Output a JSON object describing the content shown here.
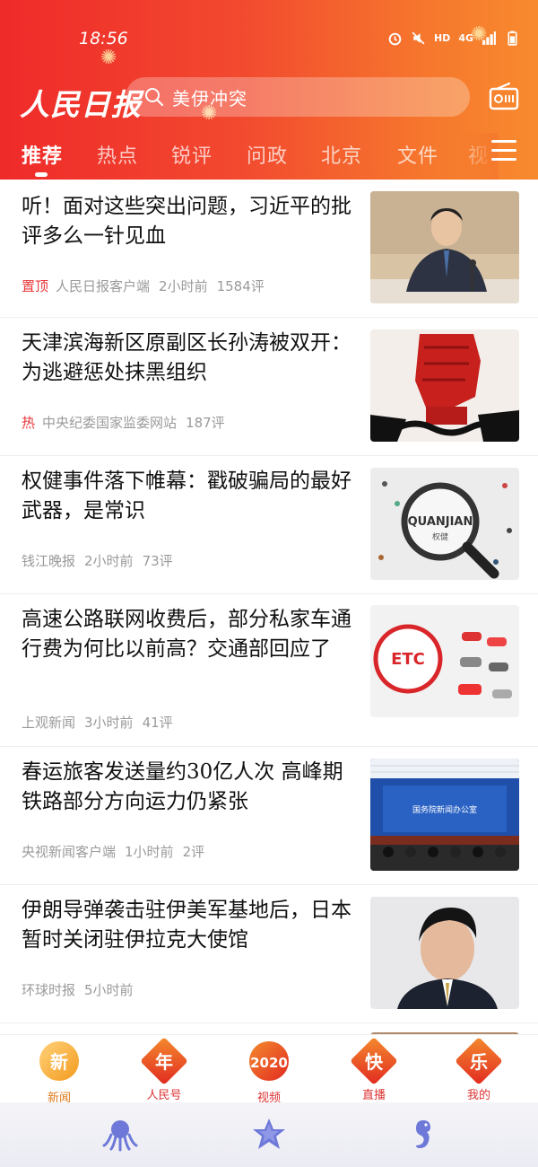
{
  "status": {
    "time": "18:56",
    "network": "4G"
  },
  "app": {
    "logo": "人民日报",
    "search_placeholder": "美伊冲突"
  },
  "tabs": [
    {
      "label": "推荐",
      "active": true
    },
    {
      "label": "热点",
      "active": false
    },
    {
      "label": "锐评",
      "active": false
    },
    {
      "label": "问政",
      "active": false
    },
    {
      "label": "北京",
      "active": false
    },
    {
      "label": "文件",
      "active": false
    },
    {
      "label": "视",
      "active": false
    }
  ],
  "feed": [
    {
      "title": "听！面对这些突出问题，习近平的批评多么一针见血",
      "tag": "置顶",
      "source": "人民日报客户端",
      "time": "2小时前",
      "comments": "1584评",
      "thumb": "podium-speaker"
    },
    {
      "title": "天津滨海新区原副区长孙涛被双开：为逃避惩处抹黑组织",
      "tag": "热",
      "source": "中央纪委国家监委网站",
      "time": "",
      "comments": "187评",
      "thumb": "red-fist"
    },
    {
      "title": "权健事件落下帷幕：戳破骗局的最好武器，是常识",
      "tag": "",
      "source": "钱江晚报",
      "time": "2小时前",
      "comments": "73评",
      "thumb": "magnifier",
      "thumb_text": "QUANJIAN",
      "thumb_subtext": "权健"
    },
    {
      "title": "高速公路联网收费后，部分私家车通行费为何比以前高？交通部回应了",
      "tag": "",
      "source": "上观新闻",
      "time": "3小时前",
      "comments": "41评",
      "thumb": "etc-cars",
      "thumb_text": "ETC"
    },
    {
      "title": "春运旅客发送量约30亿人次 高峰期铁路部分方向运力仍紧张",
      "tag": "",
      "source": "央视新闻客户端",
      "time": "1小时前",
      "comments": "2评",
      "thumb": "press-conference",
      "thumb_text": "国务院新闻办公室"
    },
    {
      "title": "伊朗导弹袭击驻伊美军基地后，日本暂时关闭驻伊拉克大使馆",
      "tag": "",
      "source": "环球时报",
      "time": "5小时前",
      "comments": "",
      "thumb": "portrait"
    }
  ],
  "bottom_nav": [
    {
      "glyph": "新",
      "label": "新闻"
    },
    {
      "glyph": "年",
      "label": "人民号"
    },
    {
      "glyph": "2020",
      "label": "视频"
    },
    {
      "glyph": "快",
      "label": "直播"
    },
    {
      "glyph": "乐",
      "label": "我的"
    }
  ],
  "bottom_bar": [
    "octopus-icon",
    "starfish-icon",
    "seahorse-icon"
  ],
  "colors": {
    "header_start": "#ef2a2a",
    "header_end": "#f88a2e",
    "accent": "#e8373a",
    "meta": "#9a9a9a"
  }
}
